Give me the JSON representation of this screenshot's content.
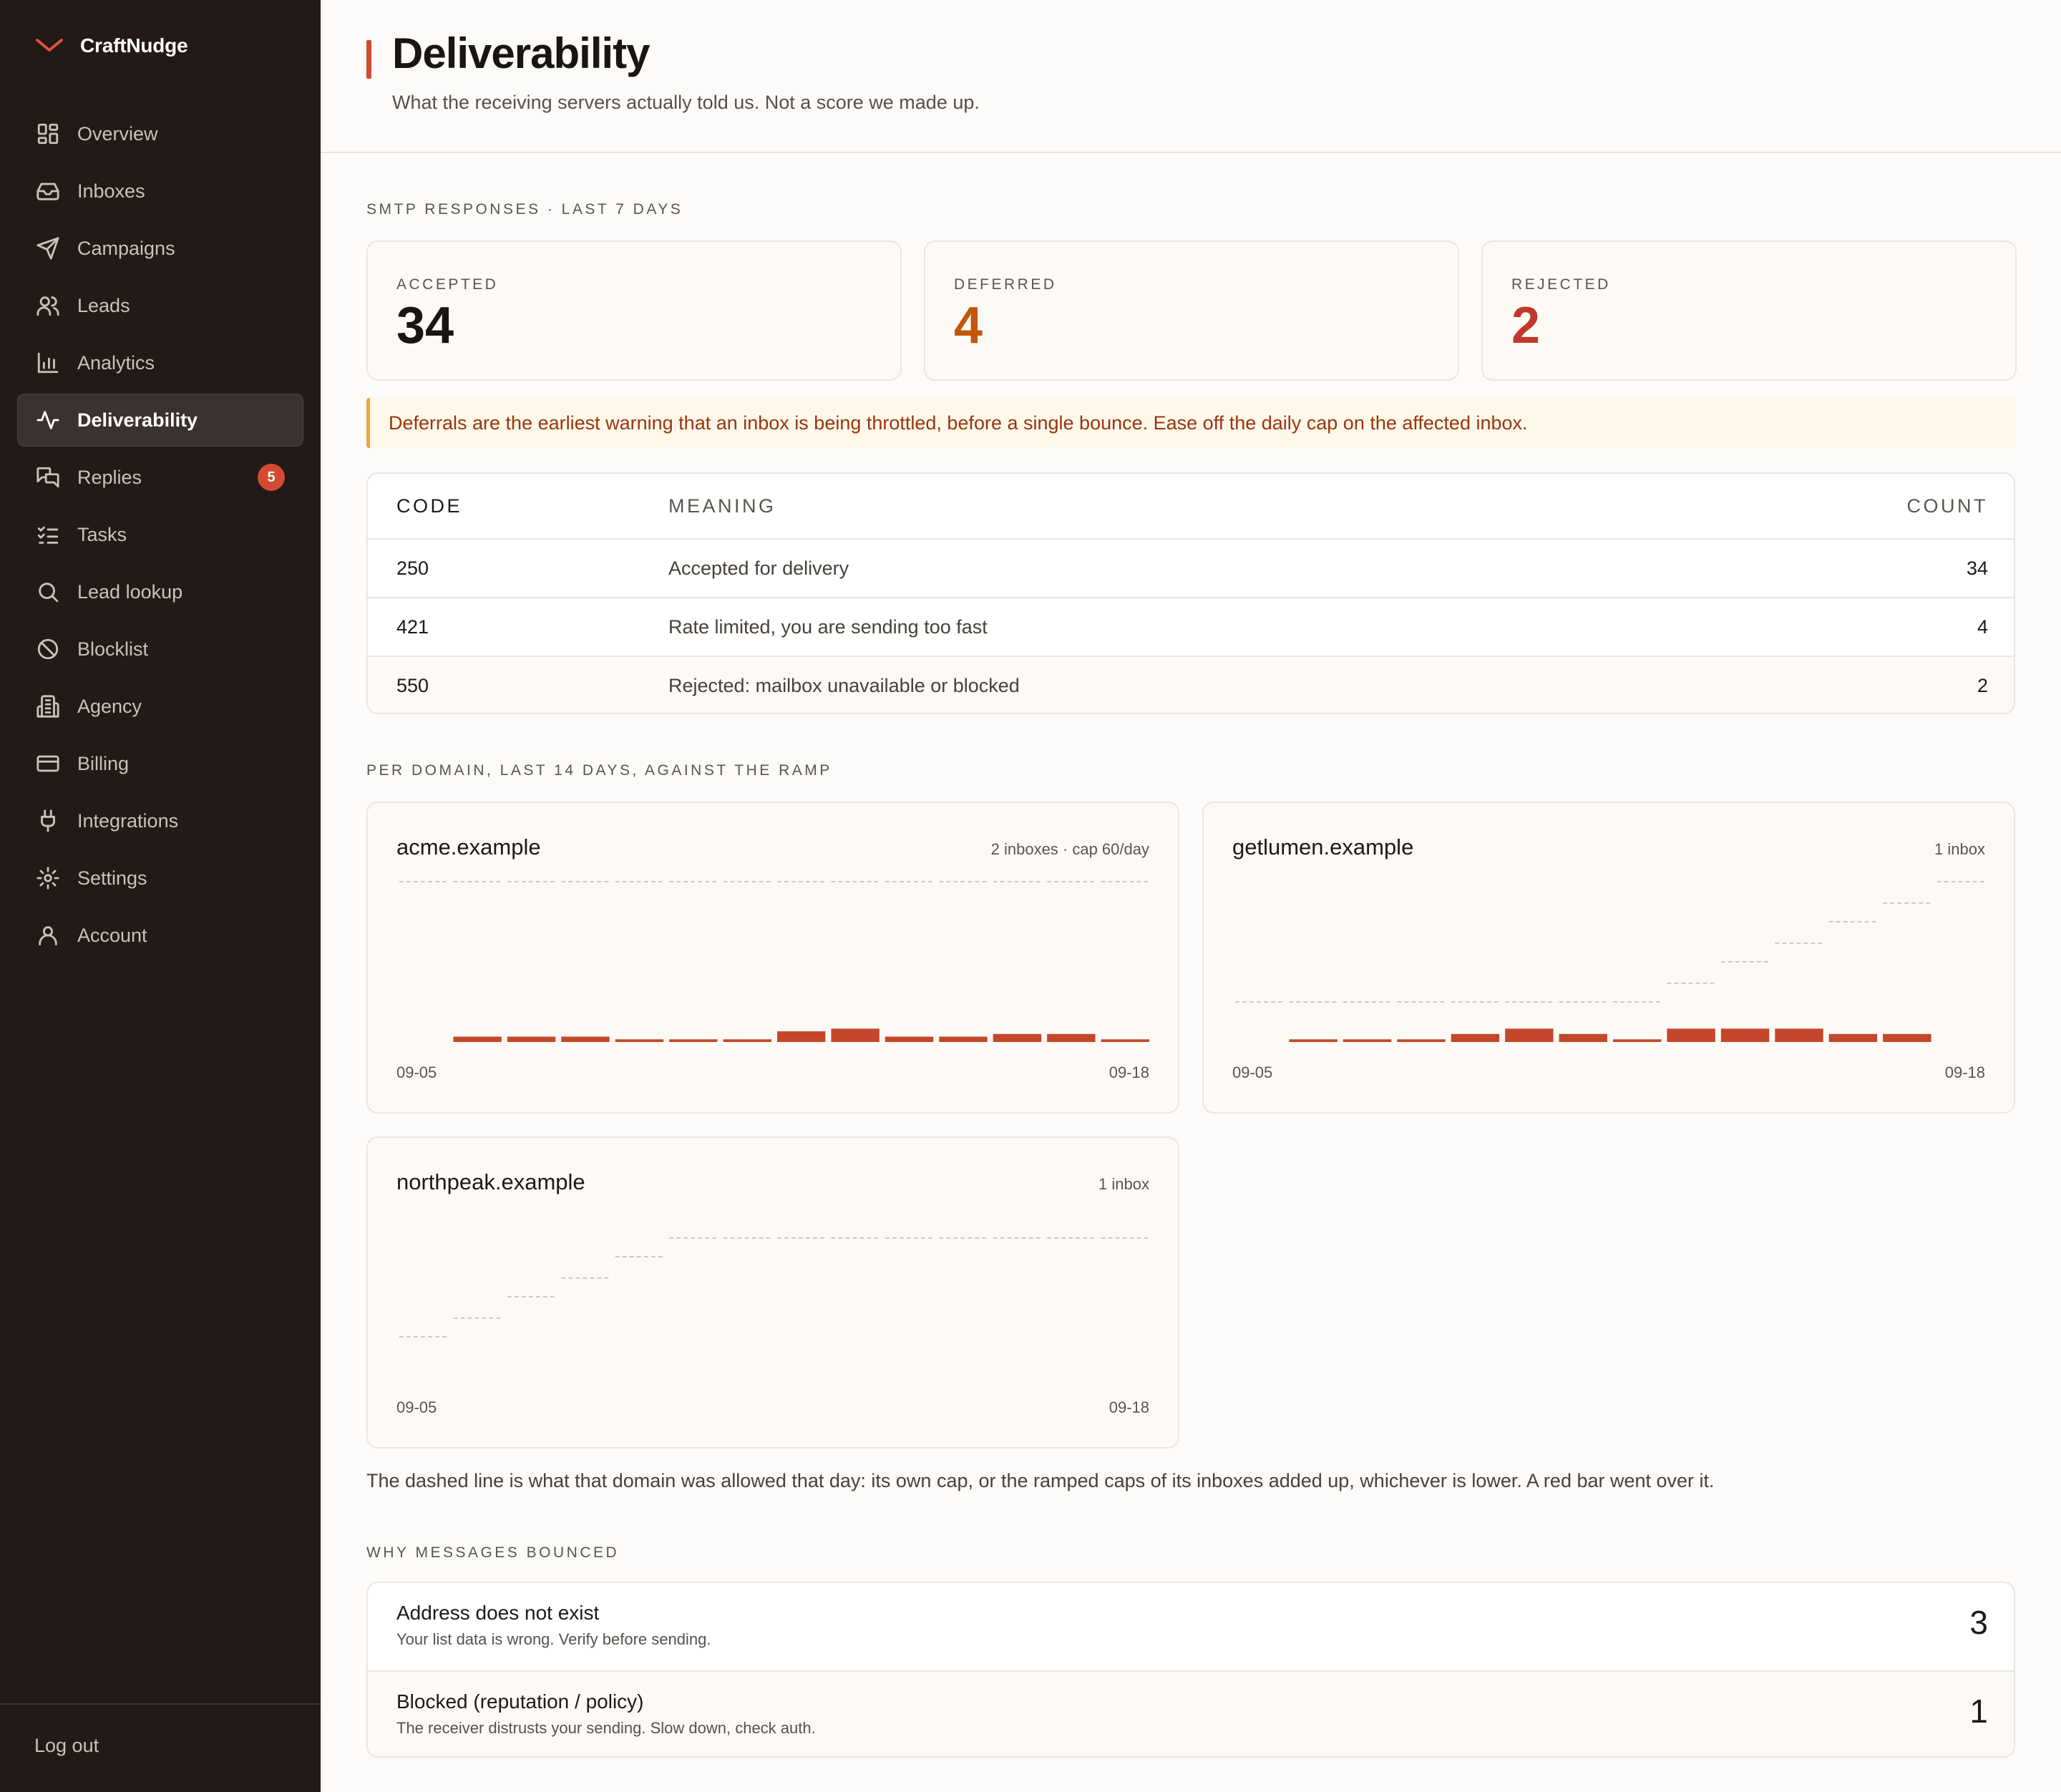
{
  "brand": {
    "name": "CraftNudge",
    "accent": "#d24a2f"
  },
  "sidebar": {
    "items": [
      {
        "label": "Overview",
        "icon": "grid-icon"
      },
      {
        "label": "Inboxes",
        "icon": "inbox-icon"
      },
      {
        "label": "Campaigns",
        "icon": "send-icon"
      },
      {
        "label": "Leads",
        "icon": "users-icon"
      },
      {
        "label": "Analytics",
        "icon": "bar-chart-icon"
      },
      {
        "label": "Deliverability",
        "icon": "activity-icon",
        "active": true
      },
      {
        "label": "Replies",
        "icon": "chat-icon",
        "badge": "5"
      },
      {
        "label": "Tasks",
        "icon": "checklist-icon"
      },
      {
        "label": "Lead lookup",
        "icon": "search-icon"
      },
      {
        "label": "Blocklist",
        "icon": "ban-icon"
      },
      {
        "label": "Agency",
        "icon": "building-icon"
      },
      {
        "label": "Billing",
        "icon": "credit-card-icon"
      },
      {
        "label": "Integrations",
        "icon": "plug-icon"
      },
      {
        "label": "Settings",
        "icon": "gear-icon"
      },
      {
        "label": "Account",
        "icon": "user-icon"
      }
    ],
    "logout": "Log out"
  },
  "header": {
    "title": "Deliverability",
    "subtitle": "What the receiving servers actually told us. Not a score we made up."
  },
  "smtp": {
    "section_label": "SMTP RESPONSES · LAST 7 DAYS",
    "stats": [
      {
        "label": "ACCEPTED",
        "value": "34",
        "color": "#1a1513"
      },
      {
        "label": "DEFERRED",
        "value": "4",
        "color": "#c2560c"
      },
      {
        "label": "REJECTED",
        "value": "2",
        "color": "#c0392b"
      }
    ],
    "notice": "Deferrals are the earliest warning that an inbox is being throttled, before a single bounce. Ease off the daily cap on the affected inbox.",
    "table": {
      "headers": {
        "code": "CODE",
        "meaning": "MEANING",
        "count": "COUNT"
      },
      "rows": [
        {
          "code": "250",
          "meaning": "Accepted for delivery",
          "count": "34"
        },
        {
          "code": "421",
          "meaning": "Rate limited, you are sending too fast",
          "count": "4"
        },
        {
          "code": "550",
          "meaning": "Rejected: mailbox unavailable or blocked",
          "count": "2"
        }
      ]
    }
  },
  "per_domain": {
    "section_label": "PER DOMAIN, LAST 14 DAYS, AGAINST THE RAMP",
    "bar_color": "#c4472c",
    "cap_color": "#cfc8c2",
    "domains": [
      {
        "name": "acme.example",
        "meta": "2 inboxes · cap 60/day",
        "from": "09-05",
        "to": "09-18",
        "max": 60,
        "caps": [
          60,
          60,
          60,
          60,
          60,
          60,
          60,
          60,
          60,
          60,
          60,
          60,
          60,
          60
        ],
        "sends": [
          0,
          2,
          2,
          2,
          1,
          1,
          1,
          4,
          5,
          2,
          2,
          3,
          3,
          1
        ]
      },
      {
        "name": "getlumen.example",
        "meta": "1 inbox",
        "from": "09-05",
        "to": "09-18",
        "max": 60,
        "caps": [
          15,
          15,
          15,
          15,
          15,
          15,
          15,
          15,
          22,
          30,
          37,
          45,
          52,
          60
        ],
        "sends": [
          0,
          1,
          1,
          1,
          3,
          5,
          3,
          1,
          5,
          5,
          5,
          3,
          3,
          0
        ]
      },
      {
        "name": "northpeak.example",
        "meta": "1 inbox",
        "from": "09-05",
        "to": "09-18",
        "max": 60,
        "caps": [
          15,
          22,
          30,
          37,
          45,
          52,
          52,
          52,
          52,
          52,
          52,
          52,
          52,
          52
        ],
        "sends": [
          0,
          0,
          0,
          0,
          0,
          0,
          0,
          0,
          0,
          0,
          0,
          0,
          0,
          0
        ]
      }
    ],
    "explanation": "The dashed line is what that domain was allowed that day: its own cap, or the ramped caps of its inboxes added up, whichever is lower. A red bar went over it."
  },
  "bounces": {
    "section_label": "WHY MESSAGES BOUNCED",
    "rows": [
      {
        "title": "Address does not exist",
        "description": "Your list data is wrong. Verify before sending.",
        "count": "3"
      },
      {
        "title": "Blocked (reputation / policy)",
        "description": "The receiver distrusts your sending. Slow down, check auth.",
        "count": "1"
      }
    ]
  }
}
